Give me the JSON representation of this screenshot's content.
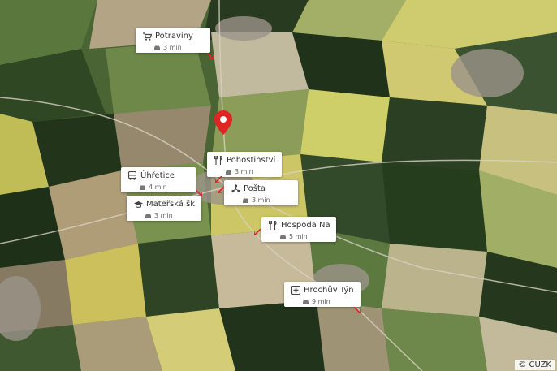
{
  "map": {
    "copyright": "© ČÚZK",
    "marker_color": "#e02424"
  },
  "pois": [
    {
      "id": "potraviny",
      "label": "Potraviny",
      "time": "3 min",
      "icon": "cart-icon"
    },
    {
      "id": "pohostinstvi",
      "label": "Pohostinství v a V",
      "time": "3 min",
      "icon": "cutlery-icon"
    },
    {
      "id": "uhretice",
      "label": "Úhřetice",
      "time": "4 min",
      "icon": "bus-icon"
    },
    {
      "id": "posta",
      "label": "Pošta",
      "time": "3 min",
      "icon": "post-icon"
    },
    {
      "id": "materska",
      "label": "Mateřská škola",
      "time": "3 min",
      "icon": "school-icon"
    },
    {
      "id": "hospoda",
      "label": "Hospoda Na Kop…",
      "time": "5 min",
      "icon": "cutlery-icon"
    },
    {
      "id": "hrochuv",
      "label": "Hrochův Týnec",
      "time": "9 min",
      "icon": "medical-icon"
    }
  ]
}
